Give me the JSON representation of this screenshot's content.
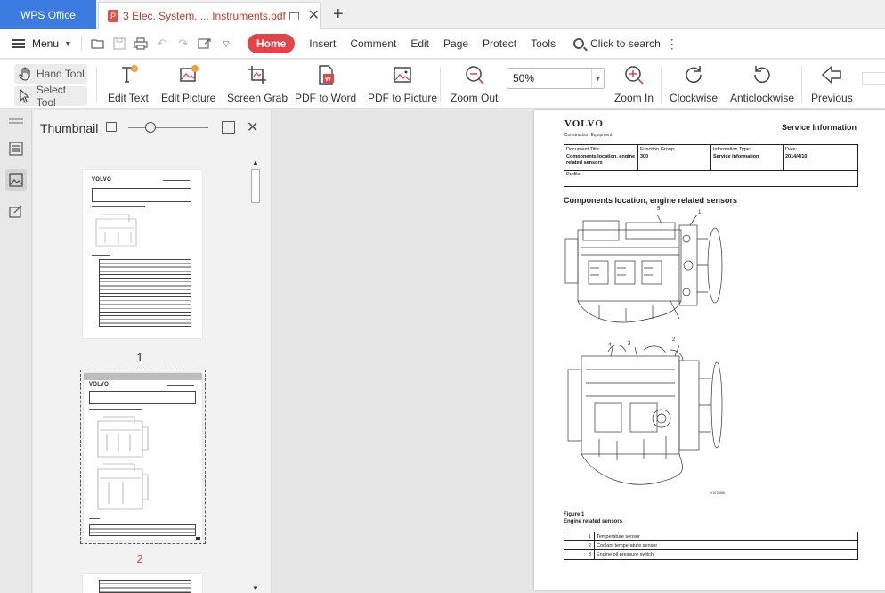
{
  "tabs": {
    "app_label": "WPS Office",
    "doc_title": "3 Elec. System, ... Instruments.pdf",
    "new_tab": "+"
  },
  "menubar": {
    "menu_label": "Menu",
    "items": [
      "Home",
      "Insert",
      "Comment",
      "Edit",
      "Page",
      "Protect",
      "Tools"
    ],
    "search_label": "Click to search"
  },
  "toolbar": {
    "hand_tool": "Hand Tool",
    "select_tool": "Select Tool",
    "edit_text": "Edit Text",
    "edit_picture": "Edit Picture",
    "screen_grab": "Screen Grab",
    "pdf_to_word": "PDF to Word",
    "pdf_to_picture": "PDF to Picture",
    "zoom_out": "Zoom Out",
    "zoom_value": "50%",
    "zoom_in": "Zoom In",
    "clockwise": "Clockwise",
    "anticlockwise": "Anticlockwise",
    "previous": "Previous"
  },
  "thumbnail_panel": {
    "title": "Thumbnail",
    "pages": [
      {
        "number": "1",
        "selected": false
      },
      {
        "number": "2",
        "selected": true
      }
    ]
  },
  "page": {
    "logo": "VOLVO",
    "logo_sub": "Construction Equipment",
    "service_info": "Service Information",
    "info": {
      "doc_title_label": "Document Title:",
      "doc_title_value": "Components location, engine related sensors",
      "function_group_label": "Function Group:",
      "function_group_value": "300",
      "info_type_label": "Information Type:",
      "info_type_value": "Service Information",
      "date_label": "Date:",
      "date_value": "2014/4/10",
      "profile_label": "Profile:"
    },
    "heading": "Components location, engine related sensors",
    "callouts": [
      "5",
      "1",
      "4",
      "3",
      "2"
    ],
    "drawing_id": "V1079686",
    "figure_label": "Figure 1",
    "figure_caption": "Engine related sensors",
    "components": [
      {
        "num": "1",
        "name": "Temperature sensor"
      },
      {
        "num": "2",
        "name": "Coolant temperature sensor"
      },
      {
        "num": "3",
        "name": "Engine oil pressure switch"
      }
    ]
  },
  "colors": {
    "app_tab": "#3c7ce0",
    "home_accent": "#e0454a",
    "doc_tab_text": "#c0392b"
  }
}
